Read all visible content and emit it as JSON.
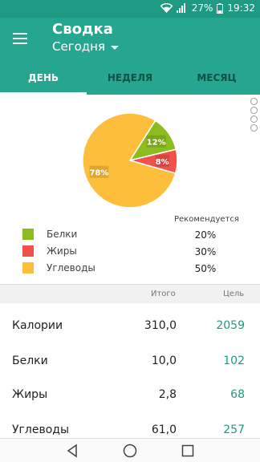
{
  "status_bar": {
    "battery": "27%",
    "time": "19:32"
  },
  "app_bar": {
    "title": "Сводка",
    "period": "Сегодня"
  },
  "tabs": [
    {
      "label": "ДЕНЬ"
    },
    {
      "label": "НЕДЕЛЯ"
    },
    {
      "label": "МЕСЯЦ"
    }
  ],
  "chart_data": {
    "type": "pie",
    "slices": [
      {
        "name": "Белки",
        "value": 12,
        "label": "12%",
        "color": "#8cbc1f"
      },
      {
        "name": "Жиры",
        "value": 8,
        "label": "8%",
        "color": "#f2504b"
      },
      {
        "name": "Углеводы",
        "value": 78,
        "label": "78%",
        "color": "#fdbf3b"
      }
    ]
  },
  "legend": {
    "items": [
      {
        "label": "Белки",
        "color": "#8cbc1f"
      },
      {
        "label": "Жиры",
        "color": "#f2504b"
      },
      {
        "label": "Углеводы",
        "color": "#fdbf3b"
      }
    ]
  },
  "recommended": {
    "title": "Рекомендуется",
    "values": [
      "20%",
      "30%",
      "50%"
    ]
  },
  "table": {
    "header_total": "Итого",
    "header_goal": "Цель",
    "rows": [
      {
        "label": "Калории",
        "total": "310,0",
        "goal": "2059"
      },
      {
        "label": "Белки",
        "total": "10,0",
        "goal": "102"
      },
      {
        "label": "Жиры",
        "total": "2,8",
        "goal": "68"
      },
      {
        "label": "Углеводы",
        "total": "61,0",
        "goal": "257"
      }
    ]
  },
  "colors": {
    "primary": "#26a68f",
    "status_bar": "#1f9a82",
    "accent_text": "#1f9a82"
  },
  "icons": [
    "wifi-icon",
    "signal-icon",
    "battery-icon",
    "menu-icon",
    "dropdown-icon",
    "back-icon",
    "home-icon",
    "recents-icon"
  ]
}
